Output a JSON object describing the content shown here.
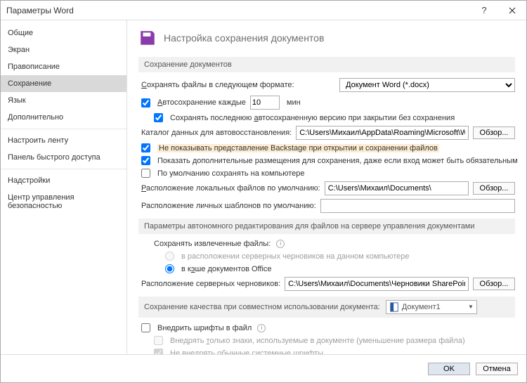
{
  "window": {
    "title": "Параметры Word"
  },
  "sidebar": {
    "items": [
      {
        "label": "Общие"
      },
      {
        "label": "Экран"
      },
      {
        "label": "Правописание"
      },
      {
        "label": "Сохранение",
        "selected": true
      },
      {
        "label": "Язык"
      },
      {
        "label": "Дополнительно"
      }
    ],
    "items2": [
      {
        "label": "Настроить ленту"
      },
      {
        "label": "Панель быстрого доступа"
      }
    ],
    "items3": [
      {
        "label": "Надстройки"
      },
      {
        "label": "Центр управления безопасностью"
      }
    ]
  },
  "header": {
    "title": "Настройка сохранения документов"
  },
  "sec1": {
    "title": "Сохранение документов",
    "save_format_label": "Сохранять файлы в следующем формате:",
    "save_format_value": "Документ Word (*.docx)",
    "autosave_label": "Автосохранение каждые",
    "autosave_value": "10",
    "autosave_unit": "мин",
    "keep_last": "Сохранять последнюю автосохраненную версию при закрытии без сохранения",
    "autorec_label": "Каталог данных для автовосстановления:",
    "autorec_value": "C:\\Users\\Михаил\\AppData\\Roaming\\Microsoft\\Word",
    "no_backstage": "Не показывать представление Backstage при открытии и сохранении файлов",
    "show_places": "Показать дополнительные размещения для сохранения, даже если вход может быть обязательным",
    "default_pc": "По умолчанию сохранять на компьютере",
    "local_loc_label": "Расположение локальных файлов по умолчанию:",
    "local_loc_value": "C:\\Users\\Михаил\\Documents\\",
    "tmpl_loc_label": "Расположение личных шаблонов по умолчанию:",
    "tmpl_loc_value": "",
    "browse": "Обзор..."
  },
  "sec2": {
    "title": "Параметры автономного редактирования для файлов на сервере управления документами",
    "save_extracted": "Сохранять извлеченные файлы:",
    "opt_server": "в расположении серверных черновиков на данном компьютере",
    "opt_cache": "в кэше документов Office",
    "drafts_label": "Расположение серверных черновиков:",
    "drafts_value": "C:\\Users\\Михаил\\Documents\\Черновики SharePoint\\",
    "browse": "Обзор..."
  },
  "sec3": {
    "title": "Сохранение качества при совместном использовании документа:",
    "doc_name": "Документ1",
    "embed_fonts": "Внедрить шрифты в файл",
    "embed_used": "Внедрять только знаки, используемые в документе (уменьшение размера файла)",
    "no_system": "Не внедрять обычные системные шрифты"
  },
  "footer": {
    "ok": "OK",
    "cancel": "Отмена"
  }
}
